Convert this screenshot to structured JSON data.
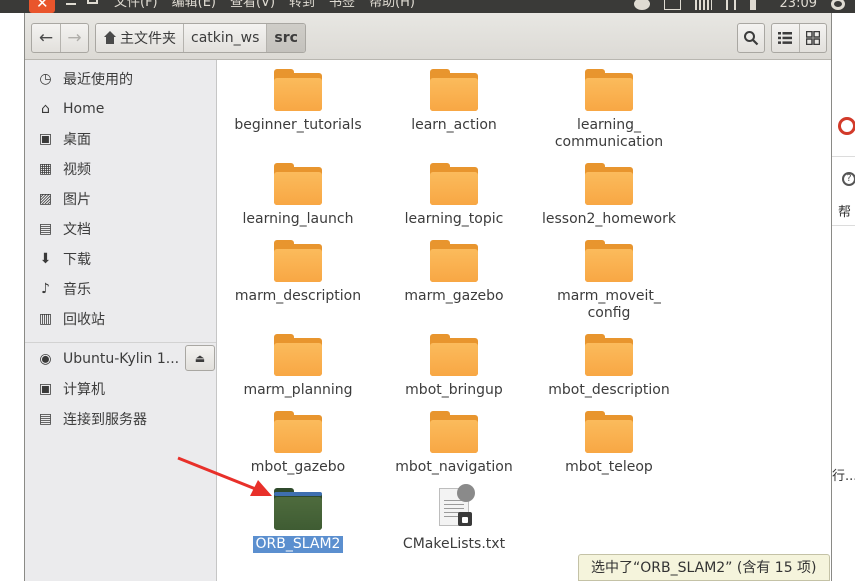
{
  "topbar": {
    "close_glyph": "✕",
    "menu": [
      "文件(F)",
      "编辑(E)",
      "查看(V)",
      "转到",
      "书签",
      "帮助(H)"
    ],
    "clock": "23:09",
    "tray_icons": [
      "user-icon",
      "keyboard-icon",
      "grid-icon",
      "network-icon",
      "volume-icon",
      "gear-icon"
    ]
  },
  "toolbar": {
    "back_glyph": "←",
    "forward_glyph": "→",
    "breadcrumbs": [
      "主文件夹",
      "catkin_ws",
      "src"
    ]
  },
  "sidebar": {
    "items": [
      {
        "label": "最近使用的",
        "icon": "clock-icon",
        "glyph": "◷"
      },
      {
        "label": "Home",
        "icon": "home-icon",
        "glyph": "⌂"
      },
      {
        "label": "桌面",
        "icon": "desktop-icon",
        "glyph": "▣"
      },
      {
        "label": "视频",
        "icon": "film-icon",
        "glyph": "▦"
      },
      {
        "label": "图片",
        "icon": "picture-icon",
        "glyph": "▨"
      },
      {
        "label": "文档",
        "icon": "document-icon",
        "glyph": "▤"
      },
      {
        "label": "下载",
        "icon": "download-icon",
        "glyph": "⬇"
      },
      {
        "label": "音乐",
        "icon": "music-icon",
        "glyph": "♪"
      },
      {
        "label": "回收站",
        "icon": "trash-icon",
        "glyph": "▥"
      }
    ],
    "devices": [
      {
        "label": "Ubuntu-Kylin 1...",
        "icon": "disc-icon",
        "glyph": "◉"
      },
      {
        "label": "计算机",
        "icon": "computer-icon",
        "glyph": "▣"
      },
      {
        "label": "连接到服务器",
        "icon": "network-server-icon",
        "glyph": "▤"
      }
    ],
    "eject_glyph": "⏏"
  },
  "files": [
    {
      "name": "beginner_tutorials",
      "type": "folder"
    },
    {
      "name": "learn_action",
      "type": "folder"
    },
    {
      "name": "learning_\ncommunication",
      "type": "folder"
    },
    {
      "name": "learning_launch",
      "type": "folder"
    },
    {
      "name": "learning_topic",
      "type": "folder"
    },
    {
      "name": "lesson2_homework",
      "type": "folder"
    },
    {
      "name": "marm_description",
      "type": "folder"
    },
    {
      "name": "marm_gazebo",
      "type": "folder"
    },
    {
      "name": "marm_moveit_\nconfig",
      "type": "folder"
    },
    {
      "name": "marm_planning",
      "type": "folder"
    },
    {
      "name": "mbot_bringup",
      "type": "folder"
    },
    {
      "name": "mbot_description",
      "type": "folder"
    },
    {
      "name": "mbot_gazebo",
      "type": "folder"
    },
    {
      "name": "mbot_navigation",
      "type": "folder"
    },
    {
      "name": "mbot_teleop",
      "type": "folder"
    },
    {
      "name": "ORB_SLAM2",
      "type": "folder",
      "selected": true
    },
    {
      "name": "CMakeLists.txt",
      "type": "text"
    }
  ],
  "status": "选中了“ORB_SLAM2” (含有 15 项)",
  "background": {
    "text_1": "帮",
    "text_2": "行..."
  },
  "colors": {
    "accent": "#e9552c",
    "selection": "#5b8fcf",
    "folder": "#f8a744"
  }
}
